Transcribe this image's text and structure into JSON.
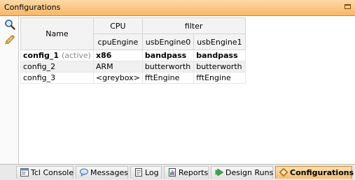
{
  "window": {
    "title": "Configurations"
  },
  "toolbar": {
    "tools": [
      "search-icon",
      "pencil-icon"
    ]
  },
  "table": {
    "name_header": "Name",
    "groups": [
      {
        "label": "CPU"
      },
      {
        "label": "filter"
      }
    ],
    "subcolumns": [
      "cpuEngine",
      "usbEngine0",
      "usbEngine1"
    ],
    "rows": [
      {
        "name": "config_1",
        "tag": "(active)",
        "cells": [
          "x86",
          "bandpass",
          "bandpass"
        ]
      },
      {
        "name": "config_2",
        "tag": "",
        "cells": [
          "ARM",
          "butterworth",
          "butterworth"
        ]
      },
      {
        "name": "config_3",
        "tag": "",
        "cells": [
          "<greybox>",
          "fftEngine",
          "fftEngine"
        ]
      }
    ]
  },
  "tabs": [
    {
      "label": "Tcl Console",
      "icon": "console-icon"
    },
    {
      "label": "Messages",
      "icon": "speech-bubble-icon"
    },
    {
      "label": "Log",
      "icon": "log-icon"
    },
    {
      "label": "Reports",
      "icon": "report-icon"
    },
    {
      "label": "Design Runs",
      "icon": "run-arrow-icon"
    },
    {
      "label": "Configurations",
      "icon": "configurations-icon",
      "selected": true
    }
  ],
  "colors": {
    "title_bar": "#f6b867",
    "selected_tab": "#f7bd6e",
    "header_bg": "#f3f3f3"
  }
}
